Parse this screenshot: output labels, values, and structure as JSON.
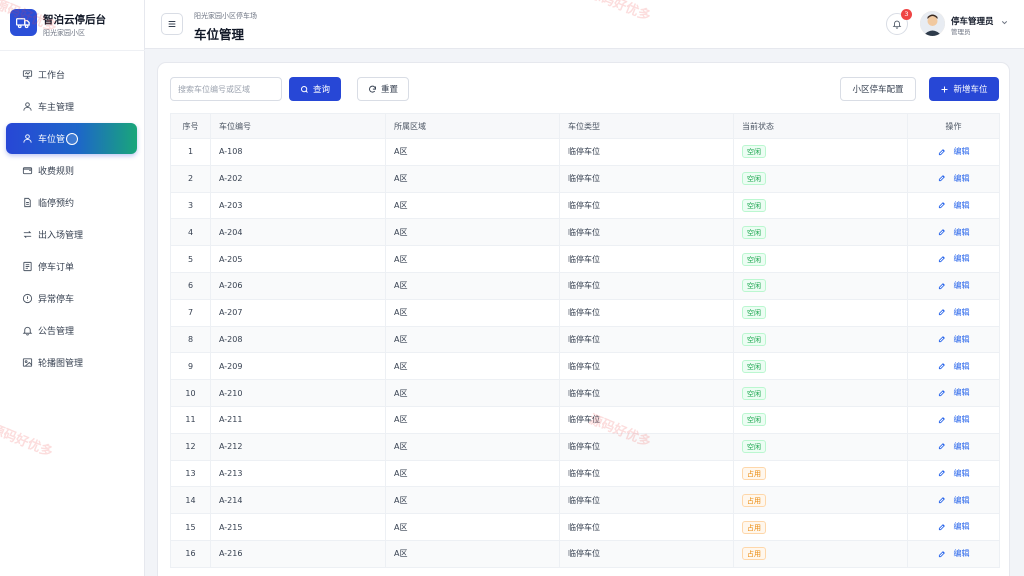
{
  "brand": {
    "title": "智泊云停后台",
    "subtitle": "阳光家园小区"
  },
  "sidebar": {
    "items": [
      {
        "label": "工作台",
        "icon": "monitor-icon"
      },
      {
        "label": "车主管理",
        "icon": "user-icon"
      },
      {
        "label": "车位管",
        "icon": "user-icon",
        "active": true
      },
      {
        "label": "收费规则",
        "icon": "wallet-icon"
      },
      {
        "label": "临停预约",
        "icon": "document-icon"
      },
      {
        "label": "出入场管理",
        "icon": "swap-arrows-icon"
      },
      {
        "label": "停车订单",
        "icon": "list-icon"
      },
      {
        "label": "异常停车",
        "icon": "alert-circle-icon"
      },
      {
        "label": "公告管理",
        "icon": "bell-icon"
      },
      {
        "label": "轮播图管理",
        "icon": "image-icon"
      }
    ]
  },
  "header": {
    "breadcrumb": "阳光家园小区停车场",
    "title": "车位管理",
    "notification_count": "3",
    "user_name": "停车管理员",
    "user_role": "管理员"
  },
  "toolbar": {
    "search_placeholder": "搜索车位编号或区域",
    "query_label": "查询",
    "reset_label": "重置",
    "config_label": "小区停车配置",
    "add_label": "新增车位"
  },
  "table": {
    "columns": [
      "序号",
      "车位编号",
      "所属区域",
      "车位类型",
      "当前状态",
      "操作"
    ],
    "edit_label": "编辑",
    "rows": [
      {
        "idx": "1",
        "code": "A-108",
        "area": "A区",
        "type": "临停车位",
        "status": "空闲",
        "status_kind": "free"
      },
      {
        "idx": "2",
        "code": "A-202",
        "area": "A区",
        "type": "临停车位",
        "status": "空闲",
        "status_kind": "free"
      },
      {
        "idx": "3",
        "code": "A-203",
        "area": "A区",
        "type": "临停车位",
        "status": "空闲",
        "status_kind": "free"
      },
      {
        "idx": "4",
        "code": "A-204",
        "area": "A区",
        "type": "临停车位",
        "status": "空闲",
        "status_kind": "free"
      },
      {
        "idx": "5",
        "code": "A-205",
        "area": "A区",
        "type": "临停车位",
        "status": "空闲",
        "status_kind": "free"
      },
      {
        "idx": "6",
        "code": "A-206",
        "area": "A区",
        "type": "临停车位",
        "status": "空闲",
        "status_kind": "free"
      },
      {
        "idx": "7",
        "code": "A-207",
        "area": "A区",
        "type": "临停车位",
        "status": "空闲",
        "status_kind": "free"
      },
      {
        "idx": "8",
        "code": "A-208",
        "area": "A区",
        "type": "临停车位",
        "status": "空闲",
        "status_kind": "free"
      },
      {
        "idx": "9",
        "code": "A-209",
        "area": "A区",
        "type": "临停车位",
        "status": "空闲",
        "status_kind": "free"
      },
      {
        "idx": "10",
        "code": "A-210",
        "area": "A区",
        "type": "临停车位",
        "status": "空闲",
        "status_kind": "free"
      },
      {
        "idx": "11",
        "code": "A-211",
        "area": "A区",
        "type": "临停车位",
        "status": "空闲",
        "status_kind": "free"
      },
      {
        "idx": "12",
        "code": "A-212",
        "area": "A区",
        "type": "临停车位",
        "status": "空闲",
        "status_kind": "free"
      },
      {
        "idx": "13",
        "code": "A-213",
        "area": "A区",
        "type": "临停车位",
        "status": "占用",
        "status_kind": "occupied"
      },
      {
        "idx": "14",
        "code": "A-214",
        "area": "A区",
        "type": "临停车位",
        "status": "占用",
        "status_kind": "occupied"
      },
      {
        "idx": "15",
        "code": "A-215",
        "area": "A区",
        "type": "临停车位",
        "status": "占用",
        "status_kind": "occupied"
      },
      {
        "idx": "16",
        "code": "A-216",
        "area": "A区",
        "type": "临停车位",
        "status": "占用",
        "status_kind": "occupied"
      }
    ]
  },
  "watermark": {
    "text": "源码好优多"
  },
  "colors": {
    "primary": "#2747d6",
    "free": "#16a34a",
    "occupied": "#ea8a0c",
    "badge": "#ef4444"
  }
}
